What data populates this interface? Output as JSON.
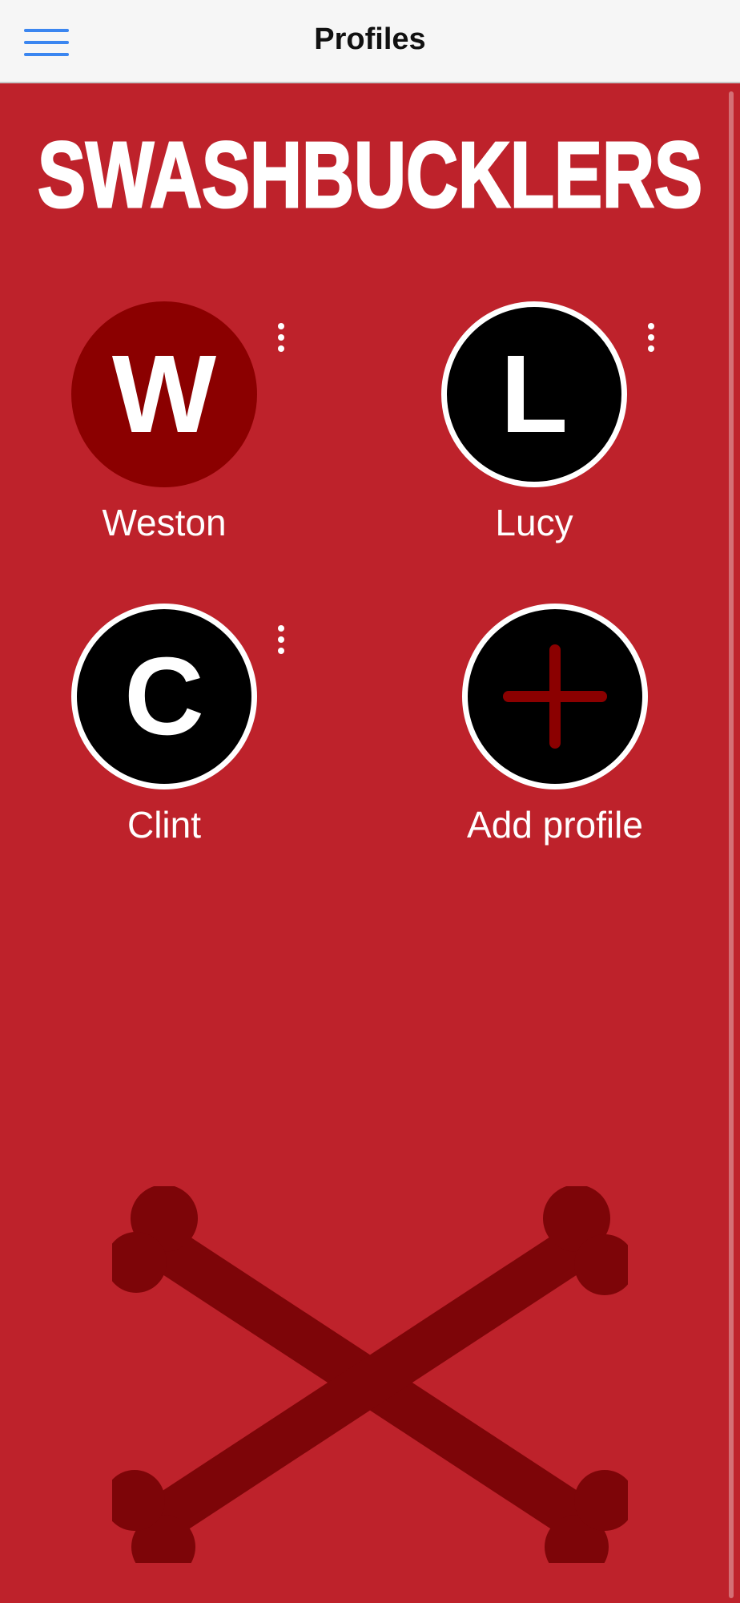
{
  "header": {
    "title": "Profiles",
    "menu_icon": "hamburger-menu-icon",
    "accent_color": "#3b86f0"
  },
  "app": {
    "brand": "SWASHBUCKLERS",
    "background_color": "#be222b",
    "active_avatar_color": "#8b0000",
    "bones_color": "#7d0508"
  },
  "profiles": [
    {
      "initial": "W",
      "name": "Weston",
      "selected": true
    },
    {
      "initial": "L",
      "name": "Lucy",
      "selected": false
    },
    {
      "initial": "C",
      "name": "Clint",
      "selected": false
    }
  ],
  "add_profile": {
    "label": "Add profile",
    "icon": "plus-icon"
  },
  "decoration": {
    "icon": "crossbones-icon"
  }
}
